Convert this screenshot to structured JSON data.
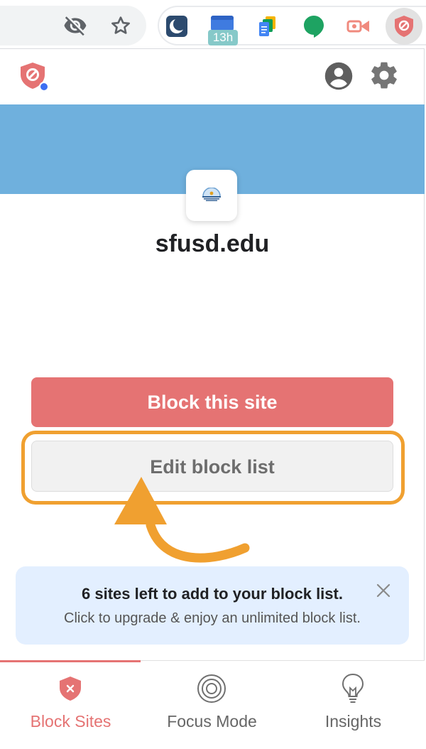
{
  "browser_toolbar": {
    "extensions": [
      {
        "name": "moon-app-icon"
      },
      {
        "name": "calendar-icon",
        "badge": "13h"
      },
      {
        "name": "docs-stack-icon"
      },
      {
        "name": "hangouts-icon"
      },
      {
        "name": "screencast-icon"
      },
      {
        "name": "blocksite-extension-icon"
      }
    ]
  },
  "popup": {
    "site_name": "sfusd.edu",
    "block_button_label": "Block this site",
    "edit_button_label": "Edit block list",
    "upsell": {
      "title": "6 sites left to add to your block list.",
      "subtitle": "Click to upgrade & enjoy an unlimited block list."
    },
    "tabs": [
      {
        "label": "Block Sites",
        "icon": "shield-x-icon",
        "active": true
      },
      {
        "label": "Focus Mode",
        "icon": "target-icon",
        "active": false
      },
      {
        "label": "Insights",
        "icon": "lightbulb-icon",
        "active": false
      }
    ]
  },
  "colors": {
    "accent": "#e57373",
    "hero": "#6fb0dd",
    "highlight": "#f0a030",
    "upsell_bg": "#e3efff"
  }
}
